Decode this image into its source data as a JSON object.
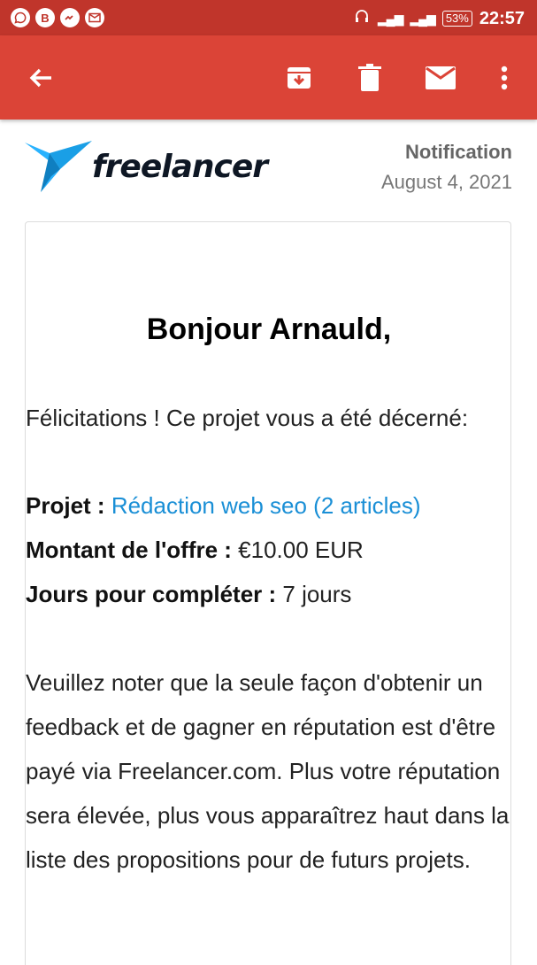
{
  "status_bar": {
    "time": "22:57",
    "battery": "53%",
    "notification_icons": [
      "whatsapp-icon",
      "b-icon",
      "messenger-icon",
      "gmail-icon"
    ],
    "color": "#c0352b"
  },
  "toolbar": {
    "color": "#db4437",
    "icons": [
      "back-arrow-icon",
      "archive-icon",
      "trash-icon",
      "mail-icon",
      "more-vert-icon"
    ]
  },
  "email": {
    "brand": "freelancer",
    "label": "Notification",
    "date": "August 4, 2021",
    "greeting": "Bonjour Arnauld,",
    "congrats": "Félicitations ! Ce projet vous a été décerné:",
    "project_label": "Projet :",
    "project_name": "Rédaction web seo (2 articles)",
    "amount_label": "Montant de l'offre :",
    "amount": "€10.00 EUR",
    "days_label": "Jours pour compléter :",
    "days": "7 jours",
    "note": "Veuillez noter que la seule façon d'obtenir un feedback et de gagner en réputation est d'être payé via Freelancer.com. Plus votre réputation sera élevée, plus vous apparaîtrez haut dans la liste des propositions pour de futurs projets.",
    "link_color": "#1a8fd6"
  }
}
